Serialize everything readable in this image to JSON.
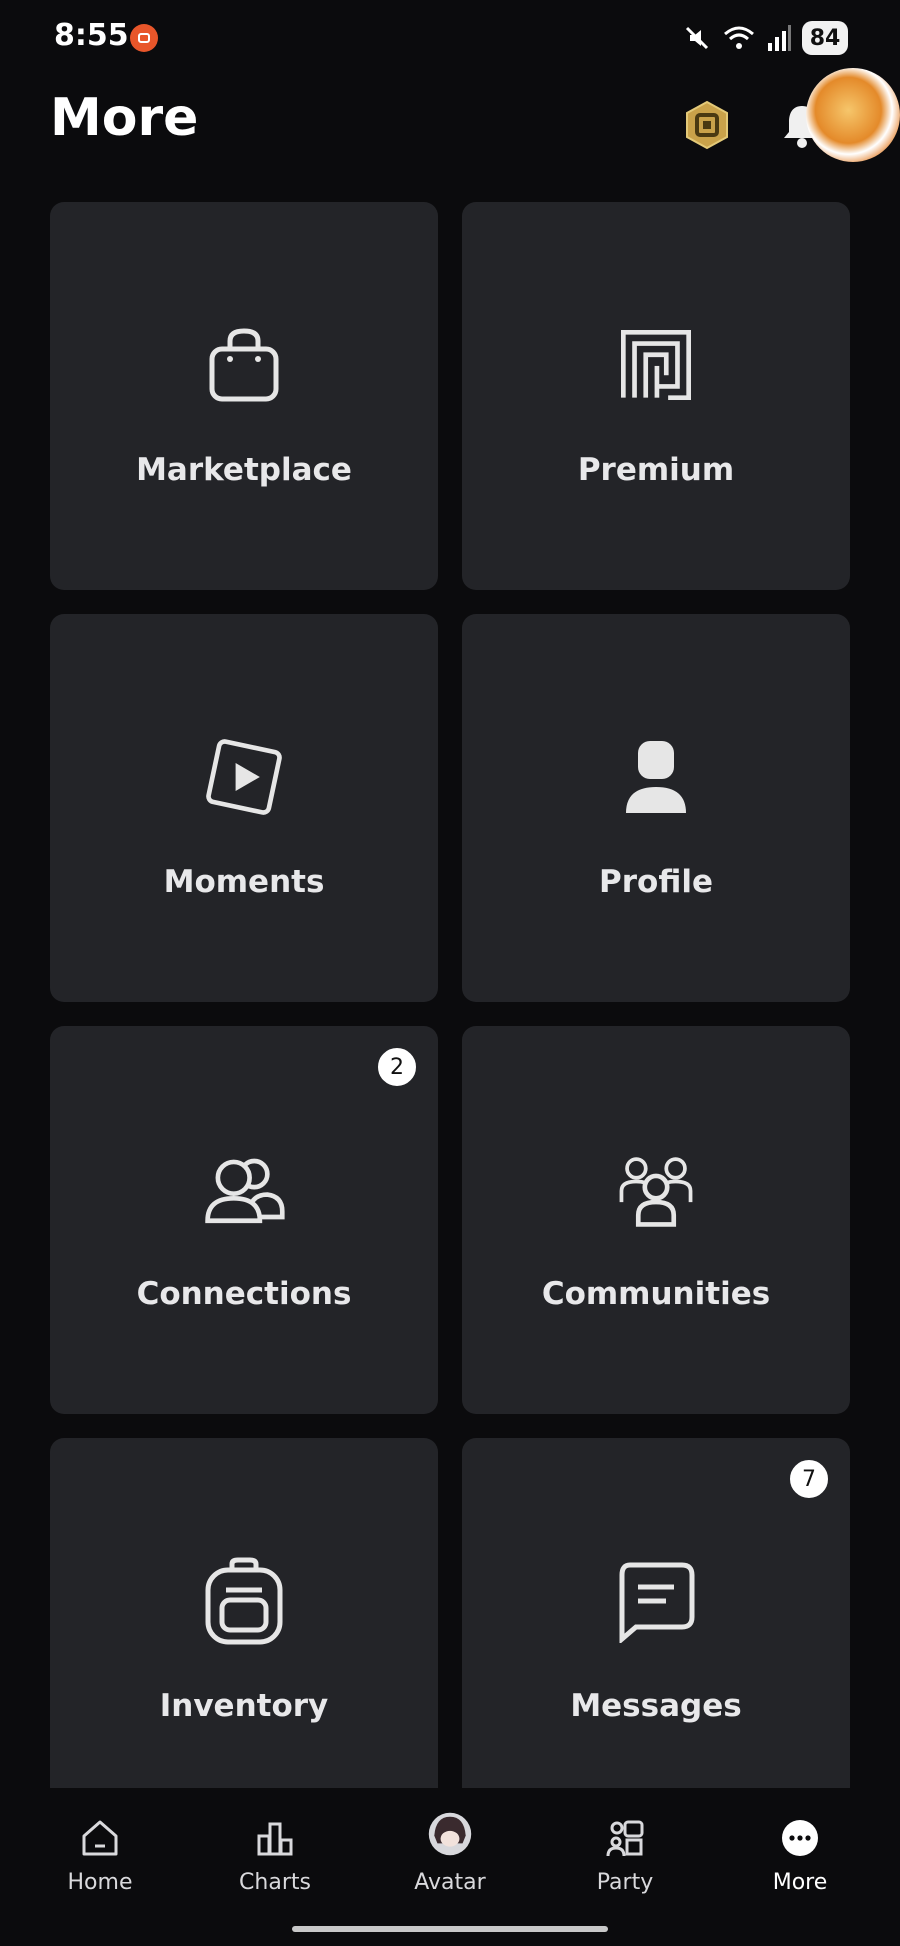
{
  "status_bar": {
    "time": "8:55",
    "battery": "84",
    "icons": [
      "screen-record-icon",
      "mute-icon",
      "wifi-icon",
      "signal-icon",
      "battery-icon"
    ]
  },
  "header": {
    "title": "More",
    "icons": [
      "robux-icon",
      "bell-icon",
      "user-avatar-icon"
    ]
  },
  "tiles": [
    {
      "label": "Marketplace",
      "icon": "shopping-bag-icon"
    },
    {
      "label": "Premium",
      "icon": "premium-icon"
    },
    {
      "label": "Moments",
      "icon": "play-icon"
    },
    {
      "label": "Profile",
      "icon": "person-icon"
    },
    {
      "label": "Connections",
      "icon": "friends-icon",
      "badge": "2"
    },
    {
      "label": "Communities",
      "icon": "group-icon"
    },
    {
      "label": "Inventory",
      "icon": "backpack-icon"
    },
    {
      "label": "Messages",
      "icon": "message-icon",
      "badge": "7"
    }
  ],
  "nav": {
    "items": [
      {
        "label": "Home",
        "icon": "home-icon"
      },
      {
        "label": "Charts",
        "icon": "charts-icon"
      },
      {
        "label": "Avatar",
        "icon": "avatar-icon"
      },
      {
        "label": "Party",
        "icon": "party-icon"
      },
      {
        "label": "More",
        "icon": "more-icon",
        "active": true
      }
    ]
  },
  "colors": {
    "background": "#0b0b0d",
    "tile": "#232428",
    "text": "#e8e8ea",
    "record": "#e8562a",
    "robux": "#c9a24a"
  }
}
